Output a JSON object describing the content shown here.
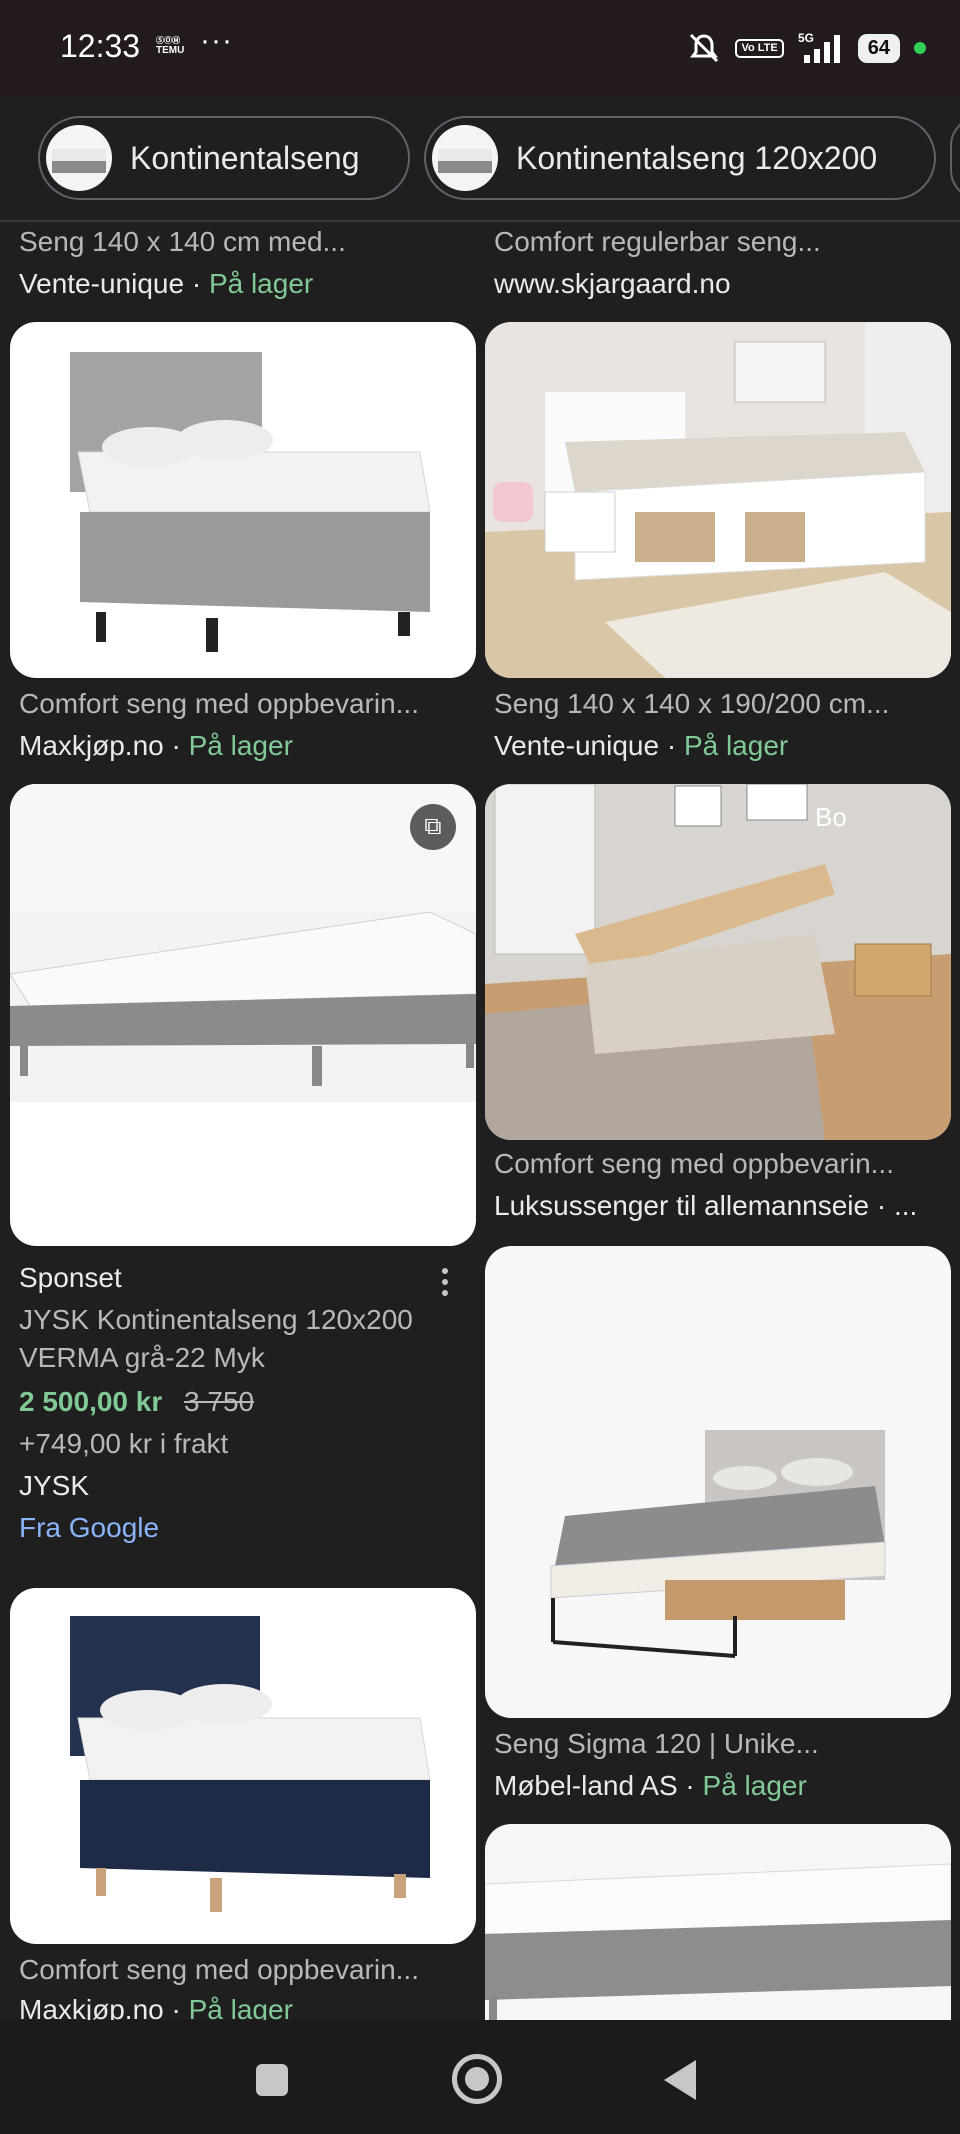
{
  "status": {
    "time": "12:33",
    "temu": "TEMU",
    "volte": "Vo LTE",
    "network": "5G",
    "battery": "64"
  },
  "chips": [
    {
      "label": "Kontinentalseng"
    },
    {
      "label": "Kontinentalseng 120x200"
    }
  ],
  "left": {
    "top_title": "Seng 140 x 140 cm med...",
    "top_source": "Vente-unique",
    "top_stock": "På lager",
    "r1": {
      "title": "Comfort seng med oppbevarin...",
      "source": "Maxkjøp.no",
      "stock": "På lager"
    },
    "sponsored": {
      "label": "Sponset",
      "title1": "JYSK Kontinentalseng 120x200",
      "title2": "VERMA grå-22 Myk",
      "price": "2 500,00 kr",
      "old_price": "3 750",
      "shipping": "+749,00 kr i frakt",
      "store": "JYSK",
      "from": "Fra Google"
    },
    "r3": {
      "title": "Comfort seng med oppbevarin...",
      "source": "Maxkjøp.no",
      "stock": "På lager"
    }
  },
  "right": {
    "top_title": "Comfort regulerbar seng...",
    "top_source": "www.skjargaard.no",
    "r1": {
      "title": "Seng 140 x 140 x 190/200 cm...",
      "source": "Vente-unique",
      "stock": "På lager"
    },
    "r2": {
      "title": "Comfort seng med oppbevarin...",
      "source": "Luksussenger til allemannseie · ...",
      "watermark": "Bo"
    },
    "r3": {
      "title": "Seng Sigma 120 | Unike...",
      "source": "Møbel-land AS",
      "stock": "På lager"
    }
  },
  "separator": " · "
}
